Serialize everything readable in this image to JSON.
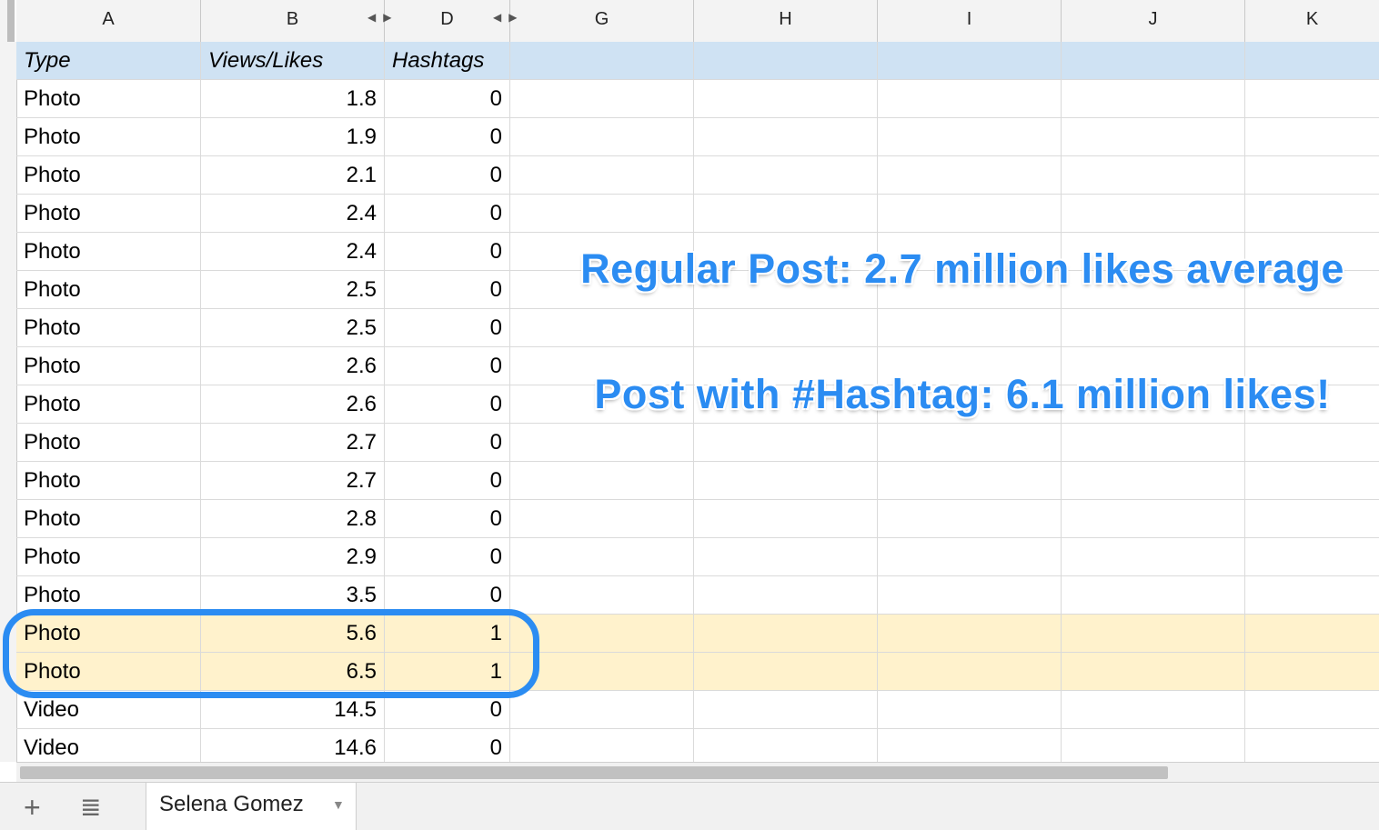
{
  "columns": [
    "A",
    "B",
    "D",
    "G",
    "H",
    "I",
    "J",
    "K"
  ],
  "header": {
    "type": "Type",
    "views": "Views/Likes",
    "hashtags": "Hashtags"
  },
  "rows": [
    {
      "type": "Photo",
      "views": "1.8",
      "hashtags": "0"
    },
    {
      "type": "Photo",
      "views": "1.9",
      "hashtags": "0"
    },
    {
      "type": "Photo",
      "views": "2.1",
      "hashtags": "0"
    },
    {
      "type": "Photo",
      "views": "2.4",
      "hashtags": "0"
    },
    {
      "type": "Photo",
      "views": "2.4",
      "hashtags": "0"
    },
    {
      "type": "Photo",
      "views": "2.5",
      "hashtags": "0"
    },
    {
      "type": "Photo",
      "views": "2.5",
      "hashtags": "0"
    },
    {
      "type": "Photo",
      "views": "2.6",
      "hashtags": "0"
    },
    {
      "type": "Photo",
      "views": "2.6",
      "hashtags": "0"
    },
    {
      "type": "Photo",
      "views": "2.7",
      "hashtags": "0"
    },
    {
      "type": "Photo",
      "views": "2.7",
      "hashtags": "0"
    },
    {
      "type": "Photo",
      "views": "2.8",
      "hashtags": "0"
    },
    {
      "type": "Photo",
      "views": "2.9",
      "hashtags": "0"
    },
    {
      "type": "Photo",
      "views": "3.5",
      "hashtags": "0"
    },
    {
      "type": "Photo",
      "views": "5.6",
      "hashtags": "1",
      "highlight": true
    },
    {
      "type": "Photo",
      "views": "6.5",
      "hashtags": "1",
      "highlight": true
    },
    {
      "type": "Video",
      "views": "14.5",
      "hashtags": "0"
    },
    {
      "type": "Video",
      "views": "14.6",
      "hashtags": "0"
    }
  ],
  "annotations": {
    "regular": "Regular Post: 2.7 million likes average",
    "hashtag": "Post with #Hashtag: 6.1 million likes!"
  },
  "colors": {
    "header_fill": "#cfe2f3",
    "highlight_fill": "#fff2cc",
    "annotation": "#2b8cf2"
  },
  "sheet_tabs": [
    {
      "label": "Selena Gomez",
      "active": true
    }
  ],
  "icons": {
    "add_sheet": "plus-icon",
    "all_sheets": "list-icon",
    "tab_menu": "caret-down-icon"
  }
}
